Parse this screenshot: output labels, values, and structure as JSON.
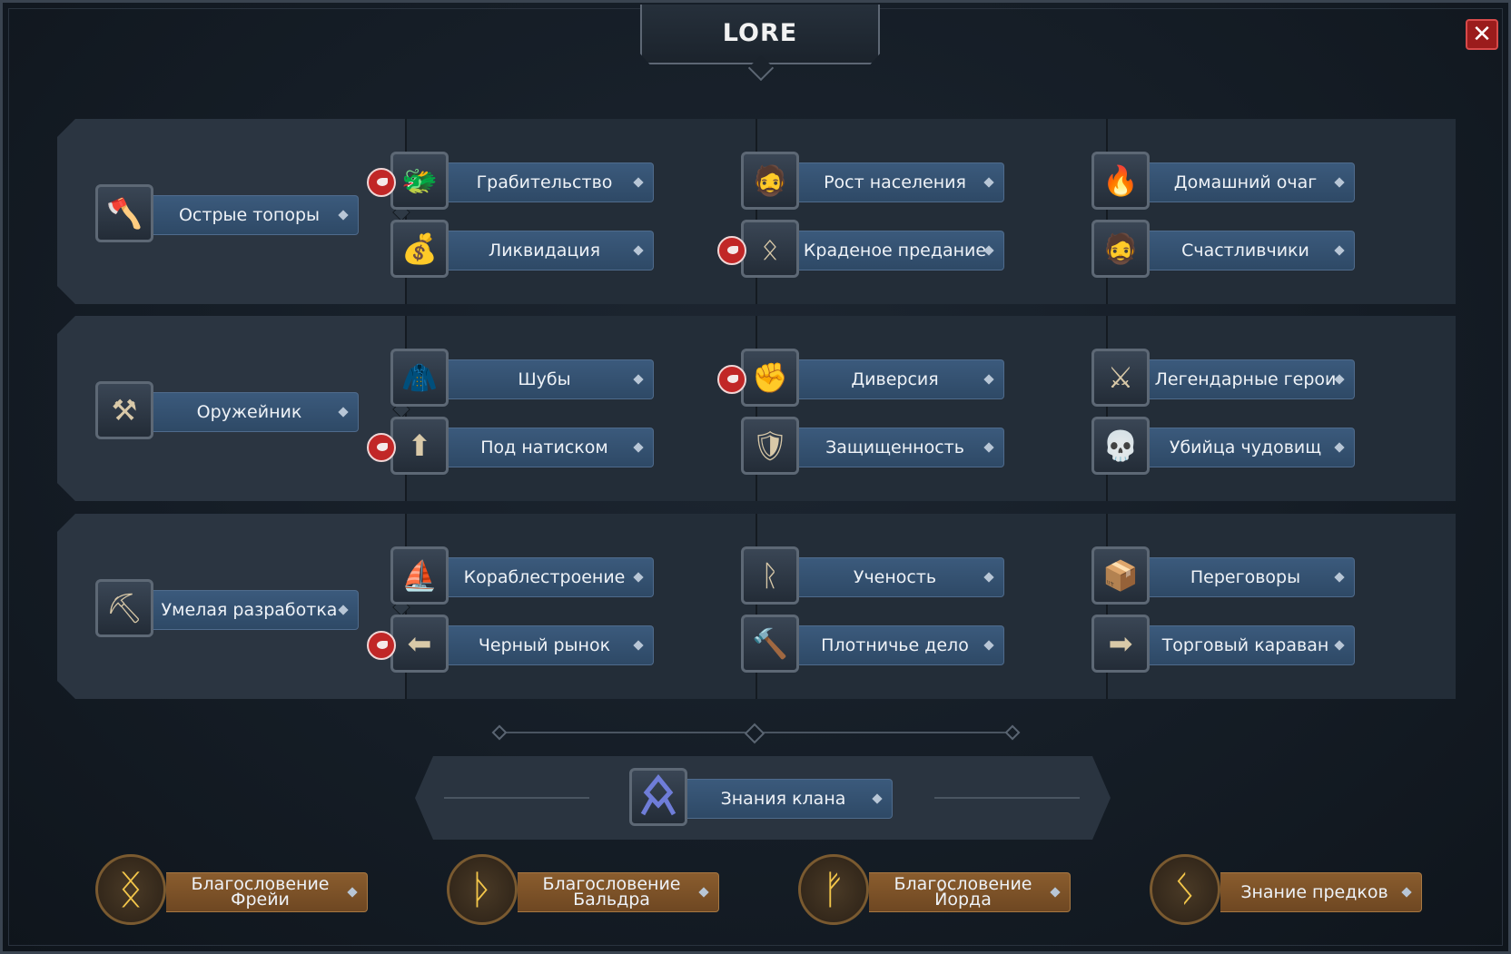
{
  "window": {
    "title": "LORE",
    "close_icon": "close-icon"
  },
  "rows": [
    {
      "main": {
        "label": "Острые топоры",
        "icon": "axes-icon"
      },
      "columns": [
        [
          {
            "label": "Грабительство",
            "icon": "dragon-hoard-icon",
            "badge": true
          },
          {
            "label": "Ликвидация",
            "icon": "loot-sack-icon",
            "badge": false
          }
        ],
        [
          {
            "label": "Рост населения",
            "icon": "villager-icon",
            "badge": false
          },
          {
            "label": "Краденое предание",
            "icon": "othala-rune-icon",
            "badge": true
          }
        ],
        [
          {
            "label": "Домашний очаг",
            "icon": "campfire-icon",
            "badge": false
          },
          {
            "label": "Счастливчики",
            "icon": "bearded-man-icon",
            "badge": false
          }
        ]
      ]
    },
    {
      "main": {
        "label": "Оружейник",
        "icon": "anvil-icon"
      },
      "columns": [
        [
          {
            "label": "Шубы",
            "icon": "fur-pelt-icon",
            "badge": false
          },
          {
            "label": "Под натиском",
            "icon": "arrow-up-map-icon",
            "badge": true
          }
        ],
        [
          {
            "label": "Диверсия",
            "icon": "fist-icon",
            "badge": true
          },
          {
            "label": "Защищенность",
            "icon": "shield-icon",
            "badge": false
          }
        ],
        [
          {
            "label": "Легендарные герои",
            "icon": "double-axe-icon",
            "badge": false
          },
          {
            "label": "Убийца чудовищ",
            "icon": "skull-icon",
            "badge": false
          }
        ]
      ]
    },
    {
      "main": {
        "label": "Умелая разработка",
        "icon": "pickaxe-icon"
      },
      "columns": [
        [
          {
            "label": "Кораблестроение",
            "icon": "ship-sail-icon",
            "badge": false
          },
          {
            "label": "Черный рынок",
            "icon": "purple-arrow-icon",
            "badge": true
          }
        ],
        [
          {
            "label": "Ученость",
            "icon": "rune-stone-icon",
            "badge": false
          },
          {
            "label": "Плотничье дело",
            "icon": "hammer-icon",
            "badge": false
          }
        ],
        [
          {
            "label": "Переговоры",
            "icon": "goods-crate-icon",
            "badge": false
          },
          {
            "label": "Торговый караван",
            "icon": "trade-arrow-icon",
            "badge": false
          }
        ]
      ]
    }
  ],
  "clan": {
    "label": "Знания клана",
    "icon": "othala-rune-icon"
  },
  "blessings": [
    {
      "label": "Благословение Фрейи",
      "icon": "freya-rune-icon"
    },
    {
      "label": "Благословение Бальдра",
      "icon": "thurisaz-rune-icon"
    },
    {
      "label": "Благословение Йорда",
      "icon": "fehu-rune-icon"
    },
    {
      "label": "Знание предков",
      "icon": "sowilo-rune-icon"
    }
  ],
  "colors": {
    "panel": "#232d38",
    "label_blue": "#2e4966",
    "label_gold": "#6e4722",
    "badge_red": "#c12727"
  }
}
